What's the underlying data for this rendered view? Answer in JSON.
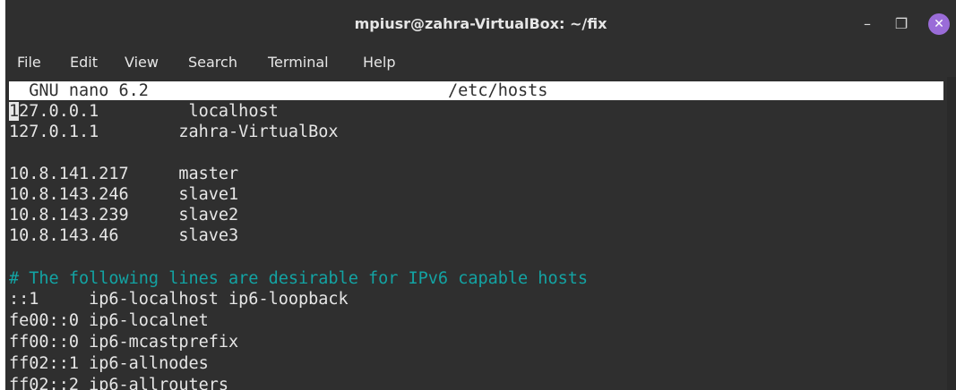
{
  "window": {
    "title": "mpiusr@zahra-VirtualBox: ~/fix",
    "controls": {
      "minimize": "–",
      "maximize": "❐",
      "close": "✕"
    }
  },
  "menu": [
    "File",
    "Edit",
    "View",
    "Search",
    "Terminal",
    "Help"
  ],
  "nano": {
    "version": "  GNU nano 6.2",
    "filename": "/etc/hosts"
  },
  "lines": {
    "l1_cursor": "1",
    "l1_rest": "27.0.0.1         localhost",
    "l2": "127.0.1.1        zahra-VirtualBox",
    "l4": "10.8.141.217     master",
    "l5": "10.8.143.246     slave1",
    "l6": "10.8.143.239     slave2",
    "l7": "10.8.143.46      slave3",
    "l9": "# The following lines are desirable for IPv6 capable hosts",
    "l10": "::1     ip6-localhost ip6-loopback",
    "l11": "fe00::0 ip6-localnet",
    "l12": "ff00::0 ip6-mcastprefix",
    "l13": "ff02::1 ip6-allnodes",
    "l14": "ff02::2 ip6-allrouters"
  },
  "colors": {
    "background": "#2f2f2f",
    "text": "#e6e6e6",
    "comment": "#13a3a3",
    "close_button": "#9a6cd8"
  }
}
